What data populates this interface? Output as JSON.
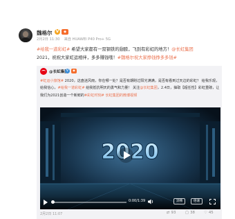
{
  "post": {
    "username": "魏格尔",
    "meta_date": "2月2日 11:30",
    "meta_source": "来自 HUAWEI P40 Pro+ 5G",
    "text_parts": {
      "tag1": "#给我一道彩虹#",
      "body1": " 希望大家都有一双钢铁的翅膀，飞到有彩虹的地方！",
      "mention": "@长虹集团",
      "body2": "2021，祝祝大家虹运相伴，多多赚钱哦！",
      "tag2": "#魏格尔祝大家挣钱挣多多钱#"
    }
  },
  "repost": {
    "username": "@长虹集团",
    "text_parts": {
      "tag1": "#虹运小旅馆#",
      "body1": " 2020，这盘迷风雨，你在哪一处？是否有期盼过阳光满满，是否有看到过天边的彩虹？ 给我乐观，给我信心，",
      "tag2": "#给我一道彩虹#",
      "body2": " 给我抵抗明天的勇气和力量！ 关注",
      "mention": "@长虹集团",
      "body3": "，2.4日，抽取【超任性】彩虹重磅，让我们为2021创造一个新鲜的",
      "tag3": "#彩虹时刻#",
      "link": " 长虹集团的微博视频"
    },
    "video": {
      "title_overlay": "2020",
      "elapsed": "0:00/1:39",
      "resolution_label": "流畅",
      "speed_label": "倍速"
    },
    "footer": {
      "date": "2月2日 11:07",
      "repost_count": "93",
      "comment_count": "38",
      "like_count": "45"
    }
  },
  "colors": {
    "accent": "#eb7350",
    "repost_bg": "#f2f2f5",
    "verified_orange": "#f5a623",
    "verified_blue": "#3b8dd8"
  },
  "icons": [
    "verified-icon",
    "level-icon",
    "play-icon",
    "volume-icon",
    "fullscreen-icon",
    "repost-icon",
    "comment-icon",
    "like-icon"
  ]
}
